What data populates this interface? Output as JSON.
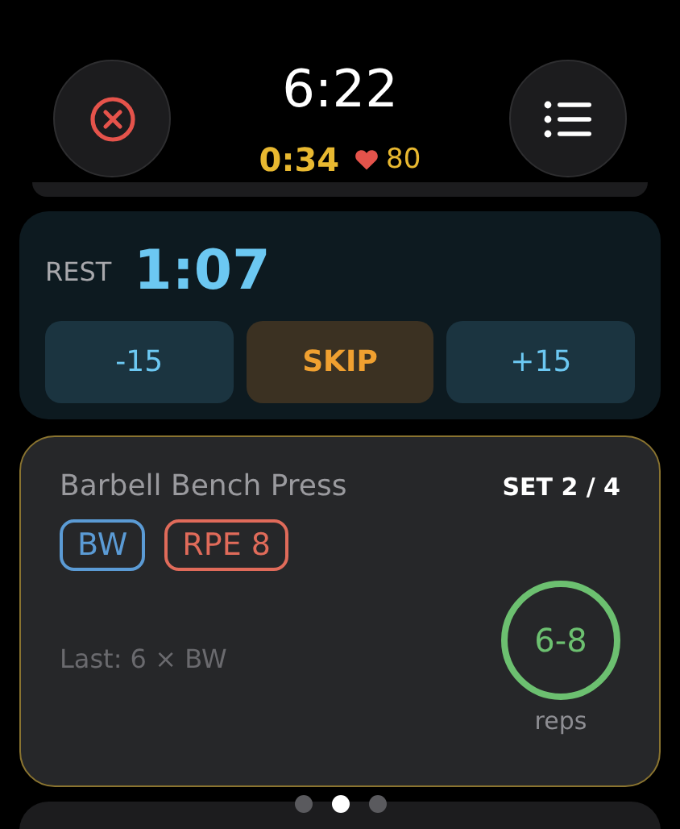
{
  "header": {
    "time": "6:22",
    "elapsed": "0:34",
    "heart_rate": "80"
  },
  "rest": {
    "label": "REST",
    "timer": "1:07",
    "buttons": [
      {
        "label": "-15",
        "kind": "adjust"
      },
      {
        "label": "SKIP",
        "kind": "skip"
      },
      {
        "label": "+15",
        "kind": "adjust"
      }
    ]
  },
  "exercise": {
    "name": "Barbell Bench Press",
    "set": "SET 2 / 4",
    "tags": [
      {
        "label": "BW",
        "color": "#5b9bd5"
      },
      {
        "label": "RPE 8",
        "color": "#e06b5a"
      }
    ],
    "last": "Last: 6 × BW",
    "target": "6-8",
    "target_unit": "reps"
  },
  "pager": [
    {
      "selected": false
    },
    {
      "selected": true
    },
    {
      "selected": false
    }
  ]
}
